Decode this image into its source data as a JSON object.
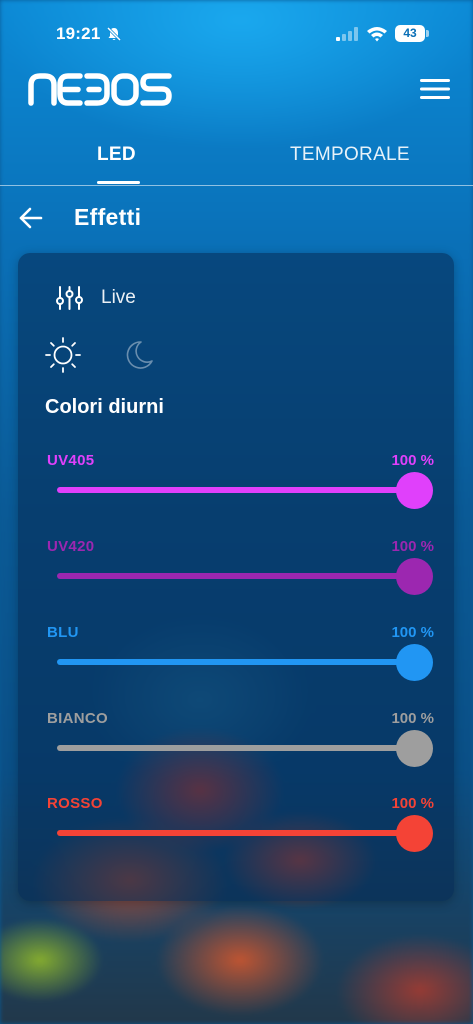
{
  "status_bar": {
    "time": "19:21",
    "battery_level": "43",
    "icons": [
      "bell-muted-icon",
      "signal-icon",
      "wifi-icon",
      "battery-icon"
    ]
  },
  "header": {
    "logo_text": "NEDOS",
    "menu_icon": "hamburger-menu-icon"
  },
  "tabs": [
    {
      "label": "LED",
      "active": true
    },
    {
      "label": "TEMPORALE",
      "active": false
    }
  ],
  "page": {
    "title": "Effetti",
    "back_icon": "arrow-left-icon"
  },
  "card": {
    "live_label": "Live",
    "mode_icons": [
      "sun-icon",
      "moon-icon"
    ],
    "active_mode": "day",
    "section_title": "Colori diurni",
    "channels": [
      {
        "label": "UV405",
        "value_text": "100 %",
        "value": 100,
        "color": "#e040fb"
      },
      {
        "label": "UV420",
        "value_text": "100 %",
        "value": 100,
        "color": "#9c27b0"
      },
      {
        "label": "BLU",
        "value_text": "100 %",
        "value": 100,
        "color": "#2196f3"
      },
      {
        "label": "BIANCO",
        "value_text": "100 %",
        "value": 100,
        "color": "#9e9e9e"
      },
      {
        "label": "ROSSO",
        "value_text": "100 %",
        "value": 100,
        "color": "#f44336"
      }
    ]
  }
}
